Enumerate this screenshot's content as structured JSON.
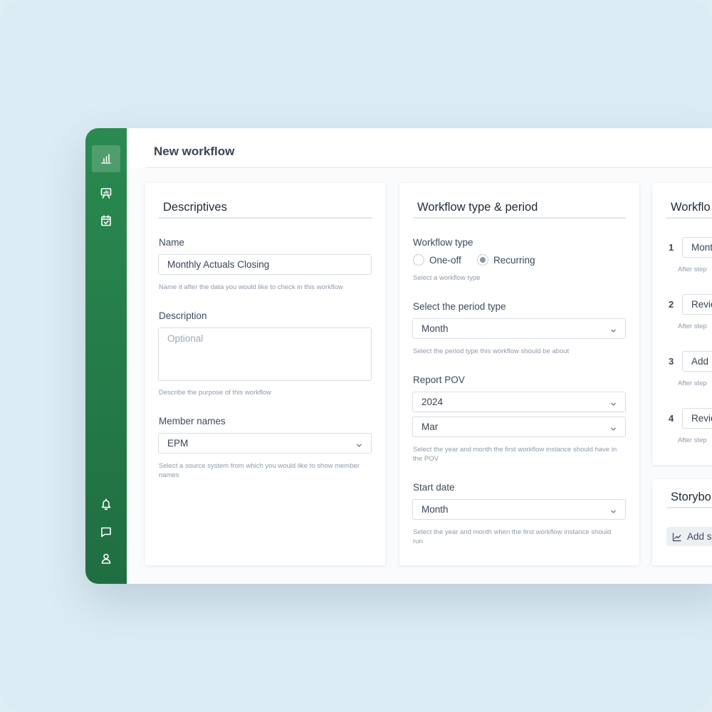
{
  "page": {
    "title": "New workflow"
  },
  "sidebar": {
    "items": [
      {
        "icon": "bar-chart-icon",
        "active": true
      },
      {
        "icon": "presentation-icon"
      },
      {
        "icon": "calendar-check-icon"
      },
      {
        "icon": "bell-icon"
      },
      {
        "icon": "chat-icon"
      },
      {
        "icon": "user-icon"
      }
    ]
  },
  "descriptives": {
    "heading": "Descriptives",
    "name_label": "Name",
    "name_value": "Monthly Actuals Closing",
    "name_help": "Name it after the data you would like to check in this workflow",
    "description_label": "Description",
    "description_placeholder": "Optional",
    "description_help": "Describe the purpose of this workflow",
    "members_label": "Member names",
    "members_value": "EPM",
    "members_help": "Select a source system from which you would like to show member names"
  },
  "type_period": {
    "heading": "Workflow type & period",
    "type_label": "Workflow type",
    "type_options": [
      "One-off",
      "Recurring"
    ],
    "type_selected": "Recurring",
    "type_help": "Select a workflow type",
    "period_label": "Select the period type",
    "period_value": "Month",
    "period_help": "Select the period type this workflow should be about",
    "pov_label": "Report POV",
    "pov_year": "2024",
    "pov_month": "Mar",
    "pov_help": "Select the year and month the first workflow instance should have in the POV",
    "start_label": "Start date",
    "start_value": "Month",
    "start_help": "Select the year and month when the first workflow instance should run"
  },
  "steps": {
    "heading": "Workflo",
    "items": [
      {
        "num": "1",
        "value": "Mont",
        "help": "After step"
      },
      {
        "num": "2",
        "value": "Revie",
        "help": "After step"
      },
      {
        "num": "3",
        "value": "Add",
        "help": "After step"
      },
      {
        "num": "4",
        "value": "Revie",
        "help": "After step"
      }
    ]
  },
  "storyboard": {
    "heading": "Storybo",
    "add_label": "Add s"
  },
  "colors": {
    "sidebar": "#1f6e42",
    "background": "#dcecf4",
    "accent": "#2a8a4f"
  }
}
